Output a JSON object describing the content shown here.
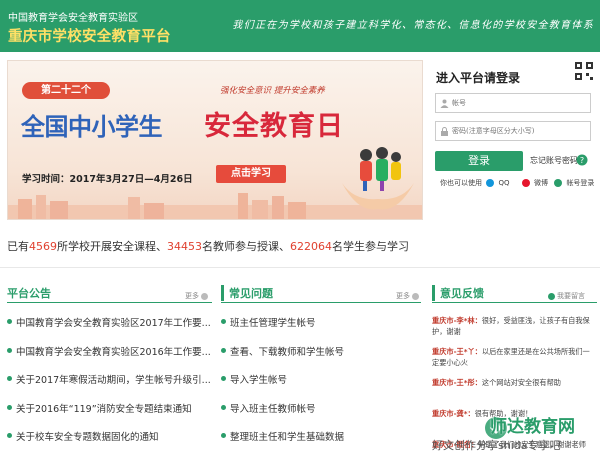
{
  "header": {
    "org": "中国教育学会安全教育实验区",
    "title": "重庆市学校安全教育平台",
    "slogan": "我们正在为学校和孩子建立科学化、常态化、信息化的学校安全教育体系"
  },
  "banner": {
    "badge": "第二十二个",
    "tagline": "强化安全意识  提升安全素养",
    "headline_a": "全国中小学生",
    "headline_b": "安全教育日",
    "date_line": "学习时间：2017年3月27日—4月26日",
    "cta": "点击学习"
  },
  "login": {
    "title": "进入平台请登录",
    "username_placeholder": "帐号",
    "password_placeholder": "密码(注意字母区分大小写)",
    "submit": "登录",
    "forgot": "忘记账号密码?",
    "alt_prefix": "你也可以使用",
    "alt_qq": "QQ",
    "alt_weibo": "微博",
    "alt_account": "帐号登录"
  },
  "stats": {
    "p1": "已有",
    "schools": "4569",
    "p2": "所学校开展安全课程、",
    "teachers": "34453",
    "p3": "名教师参与授课、",
    "students": "622064",
    "p4": "名学生参与学习"
  },
  "announcements": {
    "title": "平台公告",
    "more": "更多",
    "items": [
      "中国教育学会安全教育实验区2017年工作要...",
      "中国教育学会安全教育实验区2016年工作要...",
      "关于2017年寒假活动期间，学生帐号升级引...",
      "关于2016年“119”消防安全专题结束通知",
      "关于校车安全专题数据固化的通知"
    ]
  },
  "faq": {
    "title": "常见问题",
    "more": "更多",
    "items": [
      "班主任管理学生帐号",
      "查看、下载教师和学生帐号",
      "导入学生帐号",
      "导入班主任教师帐号",
      "整理班主任和学生基础数据"
    ]
  },
  "feedback": {
    "title": "意见反馈",
    "action": "我要留言",
    "items": [
      {
        "who": "重庆市-李*林：",
        "text": "很好，受益匪浅，让孩子有自我保护，谢谢"
      },
      {
        "who": "重庆市-王*丫：",
        "text": "以后在家里还是在公共场所我们一定要小心火"
      },
      {
        "who": "重庆市-王*彤：",
        "text": "这个网站对安全很有帮助"
      },
      {
        "who": "重庆市-龚*：",
        "text": "很有帮助，谢谢！"
      },
      {
        "who": "重庆市-匿名：",
        "text": "帮助了我们的安全意识，谢谢老师"
      }
    ]
  },
  "watermark": {
    "title": "师达教育网",
    "subtitle": "好文创作分享shida专享吧"
  },
  "colors": {
    "brand": "#2a9d6a",
    "accent": "#e0412f",
    "title_yellow": "#ffe066"
  }
}
